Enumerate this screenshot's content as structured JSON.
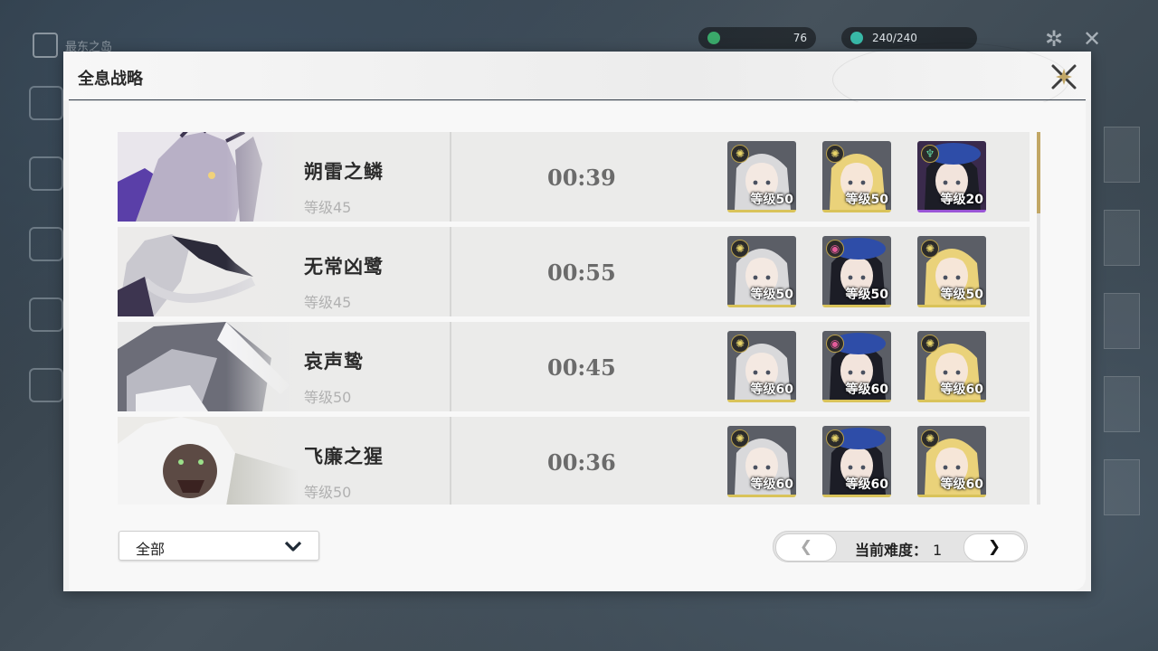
{
  "hud": {
    "location": "最东之岛",
    "currency_1": "76",
    "currency_2": "240/240"
  },
  "panel": {
    "title": "全息战略"
  },
  "bosses": [
    {
      "name": "朔雷之鳞",
      "level": "等级45",
      "time": "00:39",
      "team": [
        {
          "level": "等级50",
          "element": "spectro",
          "frame": "gold"
        },
        {
          "level": "等级50",
          "element": "spectro",
          "frame": "gold"
        },
        {
          "level": "等级20",
          "element": "aero",
          "frame": "purple"
        }
      ]
    },
    {
      "name": "无常凶鹭",
      "level": "等级45",
      "time": "00:55",
      "team": [
        {
          "level": "等级50",
          "element": "spectro",
          "frame": "gold"
        },
        {
          "level": "等级50",
          "element": "fusion",
          "frame": "gold"
        },
        {
          "level": "等级50",
          "element": "spectro",
          "frame": "gold"
        }
      ]
    },
    {
      "name": "哀声鸷",
      "level": "等级50",
      "time": "00:45",
      "team": [
        {
          "level": "等级60",
          "element": "spectro",
          "frame": "gold"
        },
        {
          "level": "等级60",
          "element": "fusion",
          "frame": "gold"
        },
        {
          "level": "等级60",
          "element": "spectro",
          "frame": "gold"
        }
      ]
    },
    {
      "name": "飞廉之猩",
      "level": "等级50",
      "time": "00:36",
      "team": [
        {
          "level": "等级60",
          "element": "spectro",
          "frame": "gold"
        },
        {
          "level": "等级60",
          "element": "spectro",
          "frame": "gold"
        },
        {
          "level": "等级60",
          "element": "spectro",
          "frame": "gold"
        }
      ]
    }
  ],
  "filter": {
    "selected": "全部"
  },
  "pager": {
    "prev_label": "❮",
    "label": "当前难度：",
    "value": "1",
    "next_label": "❯"
  },
  "colors": {
    "accent_gold": "#c2a766",
    "frame_gold": "#d9c35a",
    "frame_purple": "#9a55d6"
  }
}
